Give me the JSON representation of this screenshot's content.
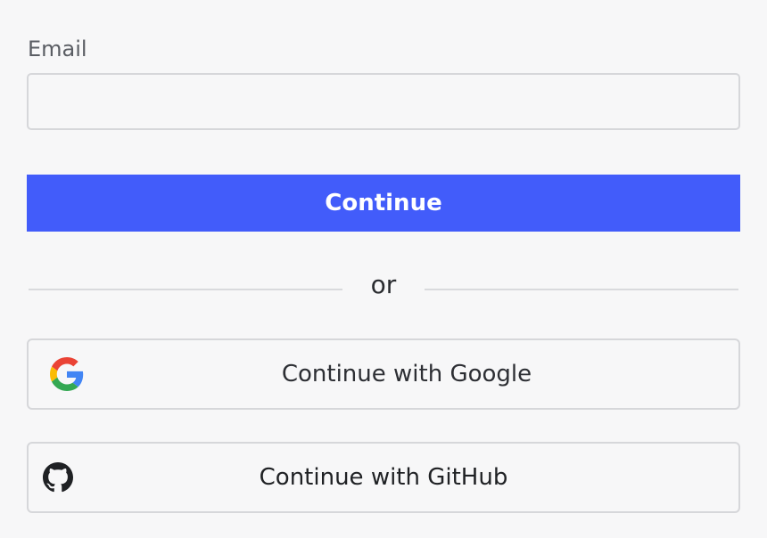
{
  "form": {
    "email_label": "Email",
    "email_value": "",
    "continue_label": "Continue",
    "divider_text": "or"
  },
  "social": {
    "google": {
      "label": "Continue with Google",
      "icon": "google-icon"
    },
    "github": {
      "label": "Continue with GitHub",
      "icon": "github-icon"
    }
  },
  "colors": {
    "accent": "#425cfa",
    "background": "#f7f7f8",
    "border": "#d6d7da"
  }
}
